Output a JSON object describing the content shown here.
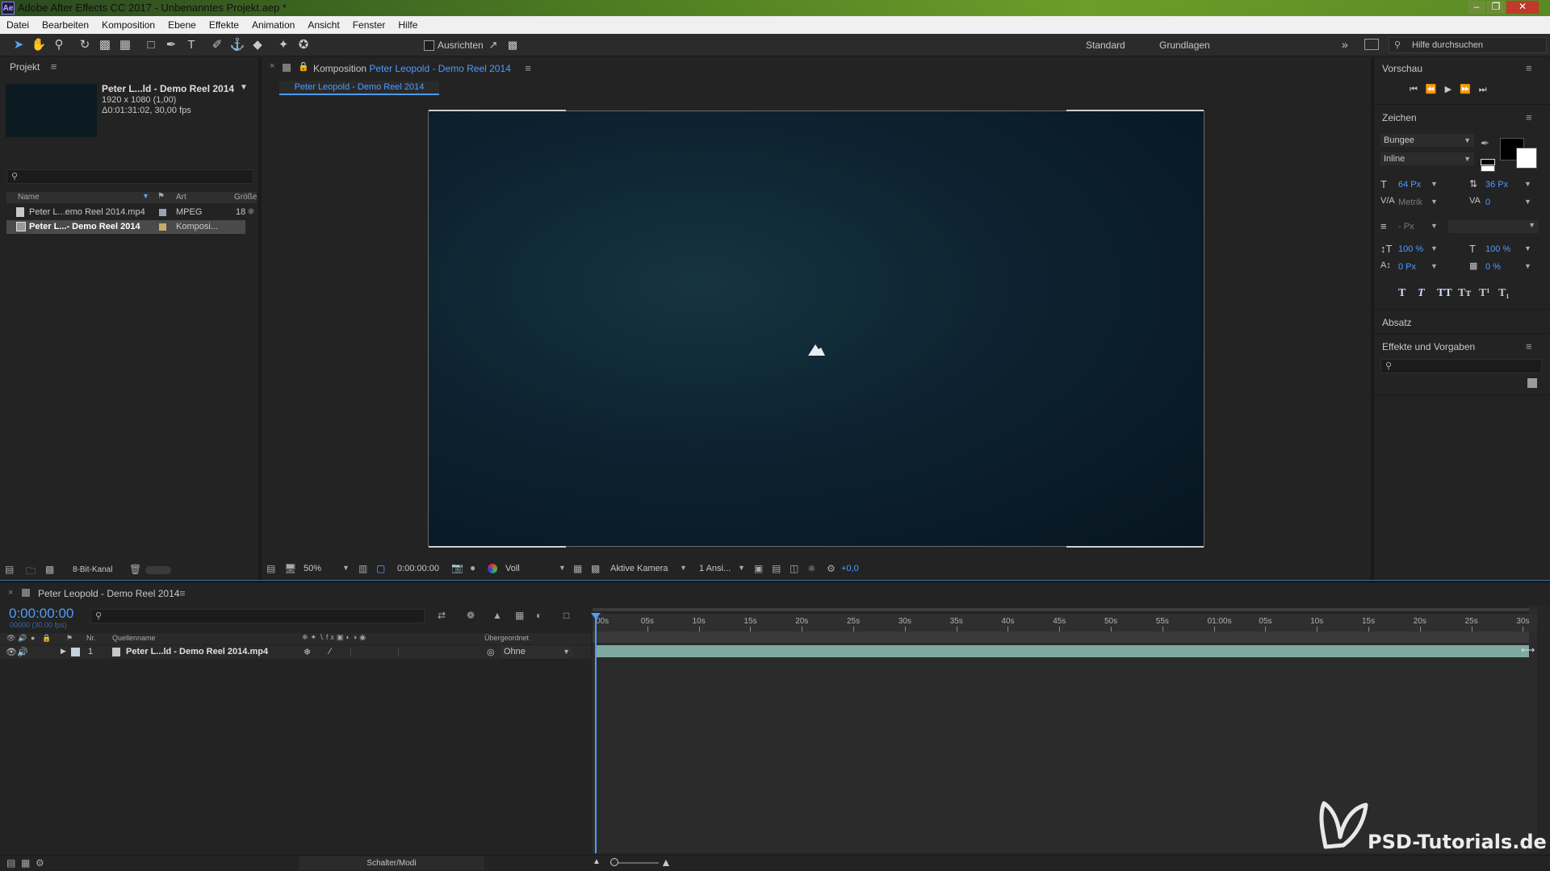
{
  "window": {
    "title": "Adobe After Effects CC 2017 - Unbenanntes Projekt.aep *",
    "app_icon_text": "Ae"
  },
  "menu": [
    "Datei",
    "Bearbeiten",
    "Komposition",
    "Ebene",
    "Effekte",
    "Animation",
    "Ansicht",
    "Fenster",
    "Hilfe"
  ],
  "toolbar": {
    "align_label": "Ausrichten",
    "workspaces": [
      "Standard",
      "Grundlagen"
    ],
    "search_placeholder": "Hilfe durchsuchen"
  },
  "project": {
    "panel_title": "Projekt",
    "selected_name": "Peter L...ld - Demo Reel 2014",
    "selected_dims": "1920 x 1080 (1,00)",
    "selected_duration": "Δ0:01:31:02, 30,00 fps",
    "columns": {
      "name": "Name",
      "type": "Art",
      "size": "Größe"
    },
    "items": [
      {
        "name": "Peter L...emo Reel 2014.mp4",
        "type": "MPEG",
        "size": "18"
      },
      {
        "name": "Peter L...- Demo Reel 2014",
        "type": "Komposi..."
      }
    ],
    "bit_depth": "8-Bit-Kanal"
  },
  "composition": {
    "panel_prefix": "Komposition",
    "panel_name": "Peter Leopold - Demo Reel 2014",
    "tab_label": "Peter Leopold - Demo Reel 2014",
    "zoom": "50%",
    "timecode": "0:00:00:00",
    "resolution": "Voll",
    "camera": "Aktive Kamera",
    "views": "1 Ansi...",
    "exposure": "+0,0"
  },
  "right_panel": {
    "preview_title": "Vorschau",
    "character_title": "Zeichen",
    "font_family": "Bungee",
    "font_style": "Inline",
    "font_size": "64 Px",
    "leading": "36 Px",
    "kerning": "Metrik",
    "tracking": "0",
    "stroke_width": "- Px",
    "vert_scale": "100 %",
    "horiz_scale": "100 %",
    "baseline_shift": "0 Px",
    "tsume": "0 %",
    "paragraph_title": "Absatz",
    "effects_title": "Effekte und Vorgaben"
  },
  "timeline": {
    "panel_name": "Peter Leopold - Demo Reel 2014",
    "timecode": "0:00:00:00",
    "timecode_sub": "00000 (30.00 fps)",
    "col_nr": "Nr.",
    "col_source": "Quellenname",
    "col_parent": "Übergeordnet",
    "layer_number": "1",
    "layer_name": "Peter L...ld - Demo Reel 2014.mp4",
    "layer_parent": "Ohne",
    "ruler_labels": [
      "00s",
      "05s",
      "10s",
      "15s",
      "20s",
      "25s",
      "30s",
      "35s",
      "40s",
      "45s",
      "50s",
      "55s",
      "01:00s",
      "05s",
      "10s",
      "15s",
      "20s",
      "25s",
      "30s"
    ],
    "footer_label": "Schalter/Modi"
  },
  "watermark": "PSD-Tutorials.de",
  "colors": {
    "accent_blue": "#4f9bff",
    "layer_bar": "#7fa9a0",
    "viewer_bg": "#0b1d28"
  }
}
